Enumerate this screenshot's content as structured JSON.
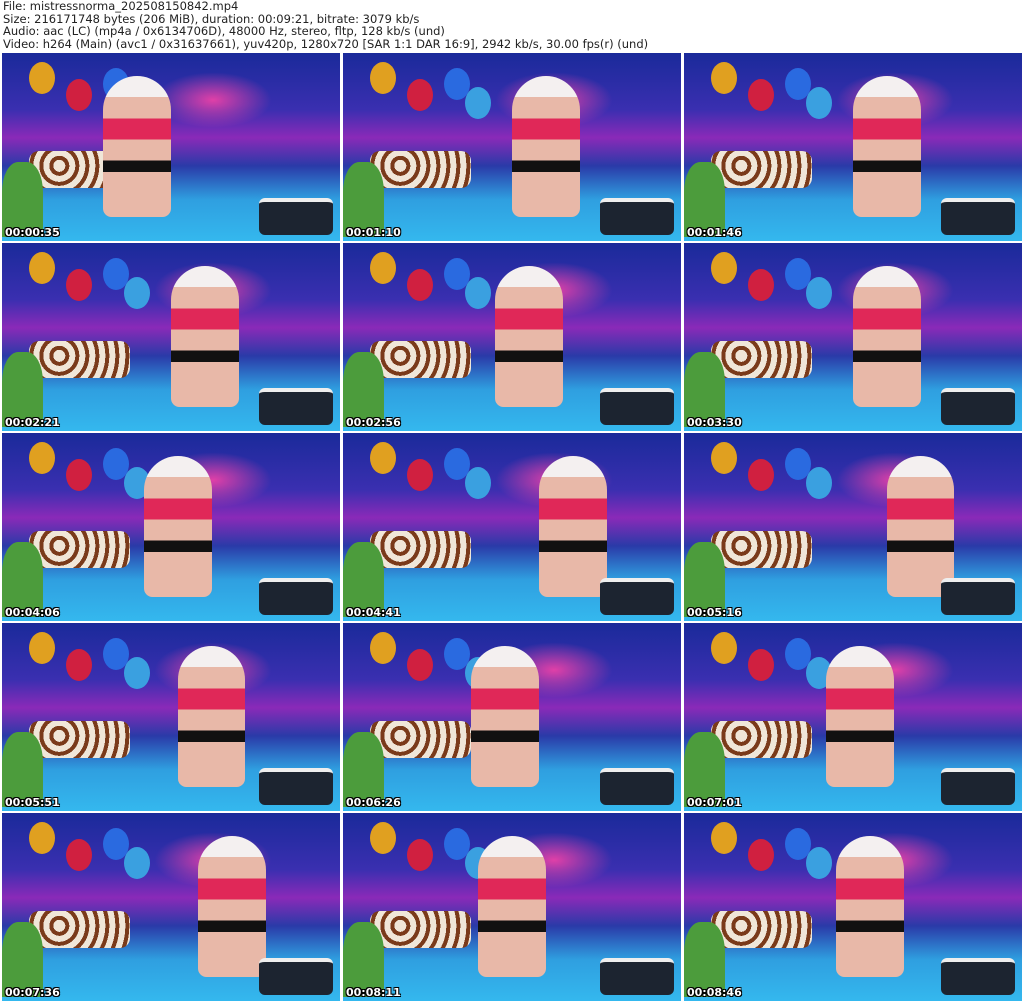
{
  "header": {
    "file": "File: mistressnorma_202508150842.mp4",
    "size": "Size: 216171748 bytes (206 MiB), duration: 00:09:21, bitrate: 3079 kb/s",
    "audio": "Audio: aac (LC) (mp4a / 0x6134706D), 48000 Hz, stereo, fltp, 128 kb/s (und)",
    "video": "Video: h264 (Main) (avc1 / 0x31637661), yuv420p, 1280x720 [SAR 1:1 DAR 16:9], 2942 kb/s, 30.00 fps(r) (und)"
  },
  "thumbnails": [
    "00:00:35",
    "00:01:10",
    "00:01:46",
    "00:02:21",
    "00:02:56",
    "00:03:30",
    "00:04:06",
    "00:04:41",
    "00:05:16",
    "00:05:51",
    "00:06:26",
    "00:07:01",
    "00:07:36",
    "00:08:11",
    "00:08:46"
  ],
  "colors": {
    "balloons": [
      "#e0a020",
      "#d02040",
      "#2a6ae0",
      "#3aa0e0"
    ]
  }
}
